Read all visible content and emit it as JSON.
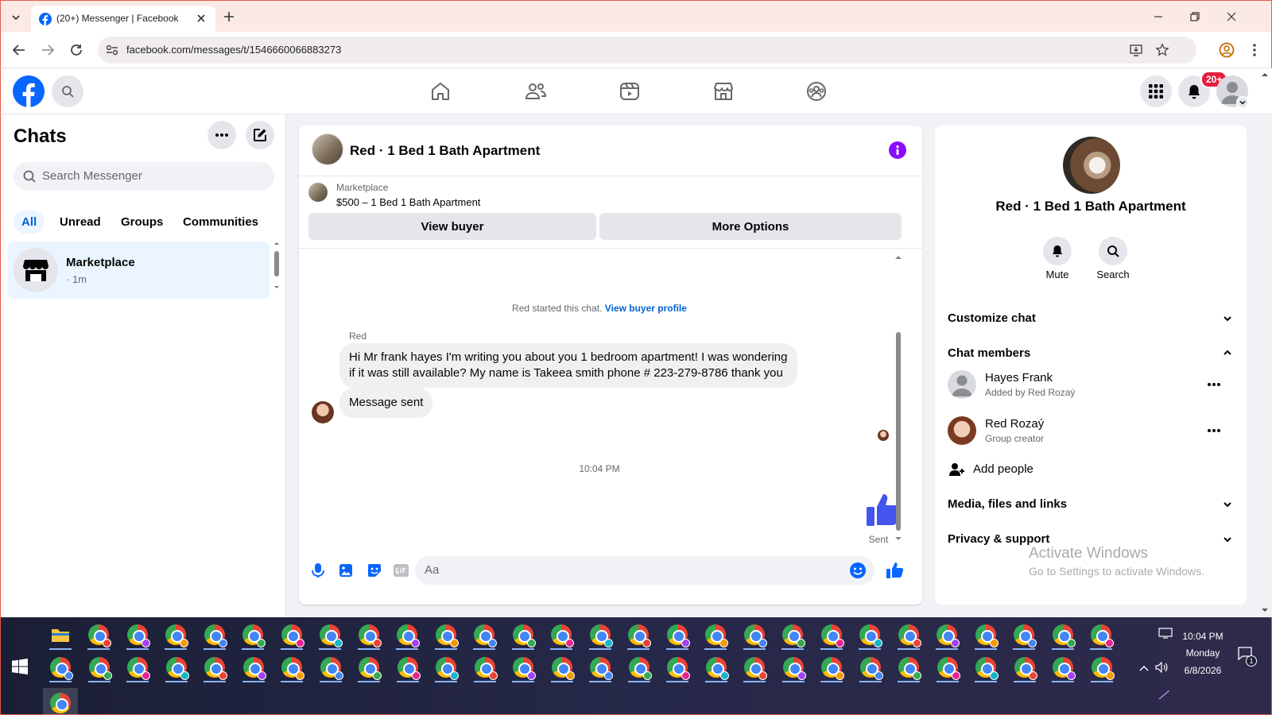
{
  "browser": {
    "tab_title": "(20+) Messenger | Facebook",
    "url": "facebook.com/messages/t/1546660066883273"
  },
  "fb_header": {
    "notification_badge": "20+"
  },
  "left": {
    "title": "Chats",
    "search_placeholder": "Search Messenger",
    "filters": [
      "All",
      "Unread",
      "Groups",
      "Communities"
    ],
    "chat_item": {
      "name": "Marketplace",
      "time": "· 1m"
    }
  },
  "conversation": {
    "title": "Red · 1 Bed 1 Bath Apartment",
    "listing_source": "Marketplace",
    "listing_title": "$500 – 1 Bed 1 Bath Apartment",
    "view_buyer": "View buyer",
    "more_options": "More Options",
    "started_text": "Red started this chat.",
    "started_link": "View buyer profile",
    "sender_name": "Red",
    "message_text": "Hi Mr frank hayes I'm writing you about you 1 bedroom apartment! I was wondering if it was still available? My name is Takeea smith phone # 223-279-8786 thank you",
    "message_status": "Message sent",
    "timestamp": "10:04 PM",
    "sent_label": "Sent",
    "composer_placeholder": "Aa"
  },
  "details": {
    "title": "Red · 1 Bed 1 Bath Apartment",
    "mute": "Mute",
    "search": "Search",
    "customize_chat": "Customize chat",
    "chat_members": "Chat members",
    "members": [
      {
        "name": "Hayes Frank",
        "role": "Added by Red Rozaý"
      },
      {
        "name": "Red Rozaý",
        "role": "Group creator"
      }
    ],
    "add_people": "Add people",
    "media_files": "Media, files and links",
    "privacy_support": "Privacy & support",
    "activate_title": "Activate Windows",
    "activate_sub": "Go to Settings to activate Windows."
  },
  "taskbar": {
    "time": "10:04 PM",
    "day": "Monday",
    "date": "6/8/2026",
    "notification_count": "1"
  },
  "colors": {
    "fb_blue": "#0866ff",
    "messenger_purple": "#8a0dff",
    "like_blue": "#4455ee"
  }
}
